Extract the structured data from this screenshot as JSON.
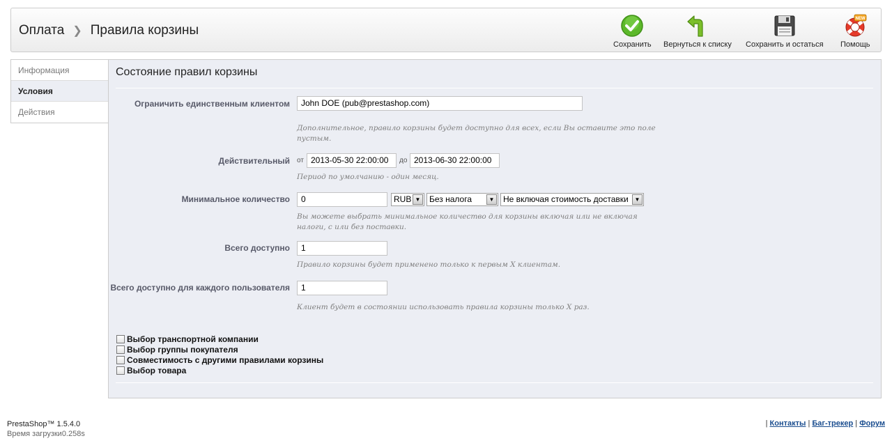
{
  "breadcrumb": {
    "first": "Оплата",
    "second": "Правила корзины"
  },
  "toolbar": {
    "save": "Сохранить",
    "back": "Вернуться к списку",
    "save_stay": "Сохранить и остаться",
    "help": "Помощь",
    "help_badge": "NEW"
  },
  "tabs": [
    {
      "label": "Информация",
      "active": false
    },
    {
      "label": "Условия",
      "active": true
    },
    {
      "label": "Действия",
      "active": false
    }
  ],
  "panel": {
    "title": "Состояние правил корзины",
    "customer": {
      "label": "Ограничить единственным клиентом",
      "value": "John DOE (pub@prestashop.com)",
      "hint": "Дополнительное, правило корзины будет доступно для всех, если Вы оставите это поле пустым."
    },
    "valid": {
      "label": "Действительный",
      "from_label": "от",
      "from_value": "2013-05-30 22:00:00",
      "to_label": "до",
      "to_value": "2013-06-30 22:00:00",
      "hint": "Период по умолчанию - один месяц."
    },
    "min_amount": {
      "label": "Минимальное количество",
      "value": "0",
      "currency": "RUB",
      "tax": "Без налога",
      "shipping": "Не включая стоимость доставки",
      "hint": "Вы можете выбрать минимальное количество для корзины включая или не включая налоги, с или без поставки."
    },
    "total_available": {
      "label": "Всего доступно",
      "value": "1",
      "hint": "Правило корзины будет применено только к первым X клиентам."
    },
    "per_user": {
      "label": "Всего доступно для каждого пользователя",
      "value": "1",
      "hint": "Клиент будет в состоянии использовать правила корзины только X раз."
    },
    "checkboxes": [
      "Выбор транспортной компании",
      "Выбор группы покупателя",
      "Совместимость с другими правилами корзины",
      "Выбор товара"
    ]
  },
  "footer": {
    "version": "PrestaShop™ 1.5.4.0",
    "load_time": "Время загрузки0.258s",
    "contacts": "Контакты",
    "bugtracker": "Баг-трекер",
    "forum": "Форум"
  },
  "colors": {
    "save_icon": "#5cb82a",
    "back_icon": "#7cbf2a",
    "accent_link": "#1a4d8f"
  }
}
